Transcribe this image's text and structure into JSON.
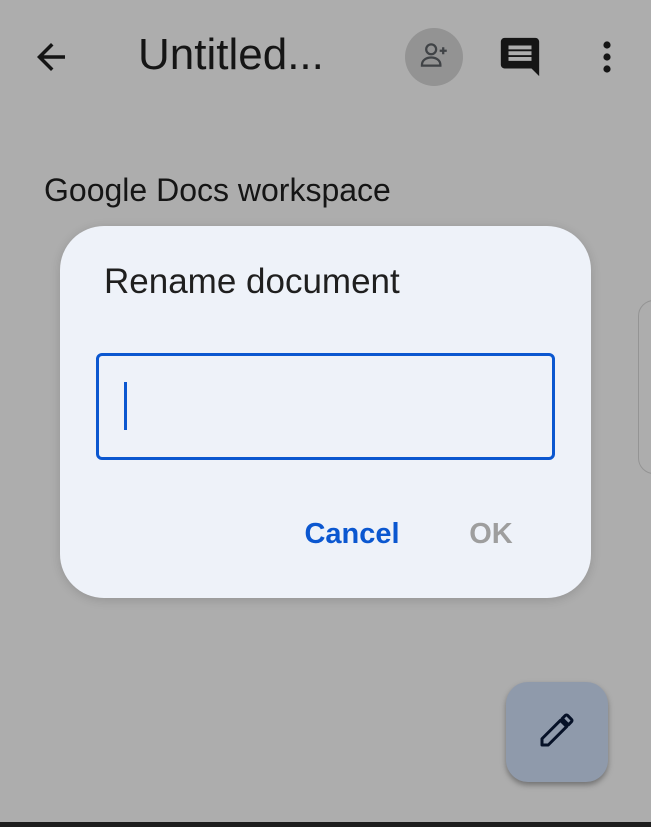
{
  "app_bar": {
    "title": "Untitled...",
    "back_icon": "arrow-back-icon",
    "share_icon": "person-add-icon",
    "comment_icon": "comment-icon",
    "more_icon": "more-vert-icon"
  },
  "document": {
    "body_text": "Google Docs workspace"
  },
  "dialog": {
    "title": "Rename document",
    "input_value": "",
    "cancel_label": "Cancel",
    "ok_label": "OK"
  },
  "fab": {
    "icon": "edit-pencil-icon"
  },
  "colors": {
    "accent": "#0b57d0",
    "dialog_bg": "#eef2f9",
    "fab_bg": "#d3e3fd",
    "disabled_text": "#9e9e9e"
  }
}
